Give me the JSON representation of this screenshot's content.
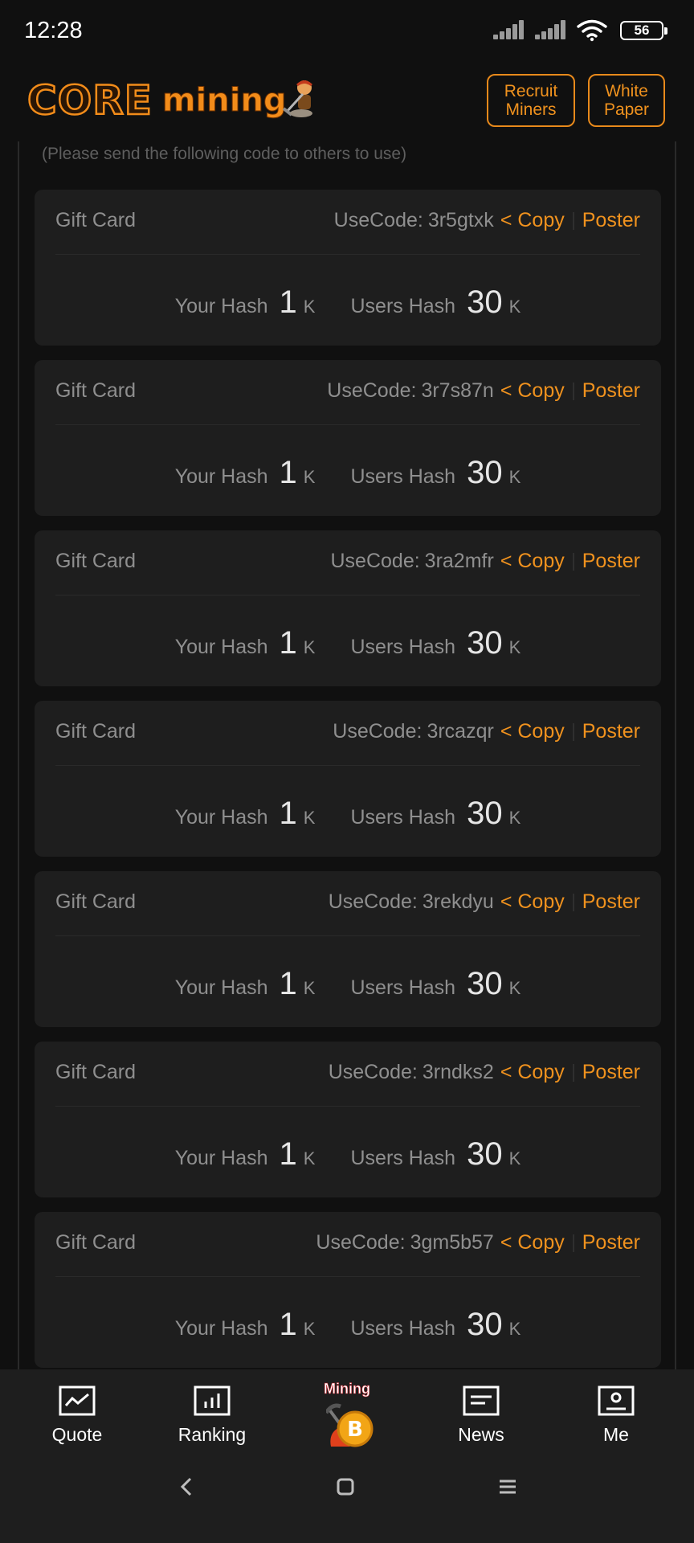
{
  "status_bar": {
    "time": "12:28",
    "battery": "56"
  },
  "header": {
    "logo_core": "CORE",
    "logo_mining": "mining",
    "recruit_label": "Recruit Miners",
    "white_paper_label": "White Paper"
  },
  "hint": "(Please send the following code to others to use)",
  "card_labels": {
    "title": "Gift Card",
    "usecode_label": "UseCode:",
    "copy": "< Copy",
    "poster": "Poster",
    "your_hash": "Your Hash",
    "users_hash": "Users Hash",
    "unit": "K"
  },
  "cards": [
    {
      "code": "3r5gtxk",
      "your_hash": "1",
      "users_hash": "30"
    },
    {
      "code": "3r7s87n",
      "your_hash": "1",
      "users_hash": "30"
    },
    {
      "code": "3ra2mfr",
      "your_hash": "1",
      "users_hash": "30"
    },
    {
      "code": "3rcazqr",
      "your_hash": "1",
      "users_hash": "30"
    },
    {
      "code": "3rekdyu",
      "your_hash": "1",
      "users_hash": "30"
    },
    {
      "code": "3rndks2",
      "your_hash": "1",
      "users_hash": "30"
    },
    {
      "code": "3gm5b57",
      "your_hash": "1",
      "users_hash": "30"
    }
  ],
  "bottom_nav": {
    "quote": "Quote",
    "ranking": "Ranking",
    "mining": "Mining",
    "news": "News",
    "me": "Me"
  },
  "colors": {
    "accent": "#f0921e",
    "background": "#101010",
    "card": "#1e1e1e"
  }
}
